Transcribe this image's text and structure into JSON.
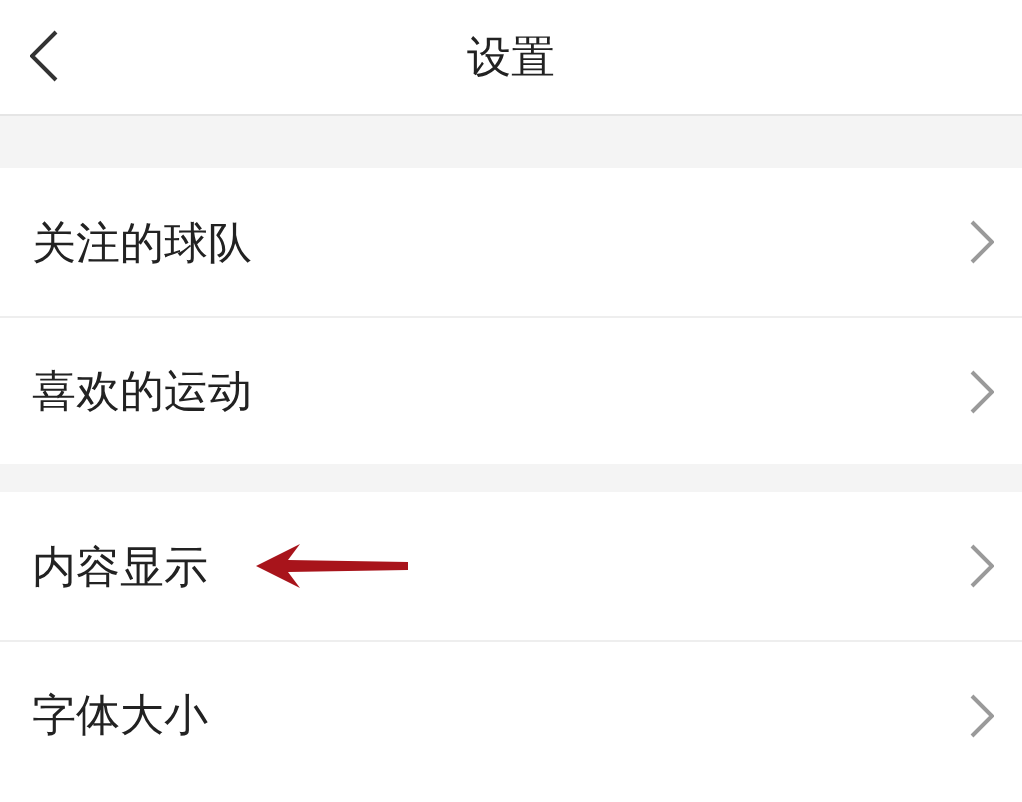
{
  "header": {
    "title": "设置"
  },
  "groups": [
    {
      "items": [
        {
          "label": "关注的球队"
        },
        {
          "label": "喜欢的运动"
        }
      ]
    },
    {
      "items": [
        {
          "label": "内容显示",
          "annotated": true
        },
        {
          "label": "字体大小",
          "annotated": false
        }
      ]
    }
  ]
}
